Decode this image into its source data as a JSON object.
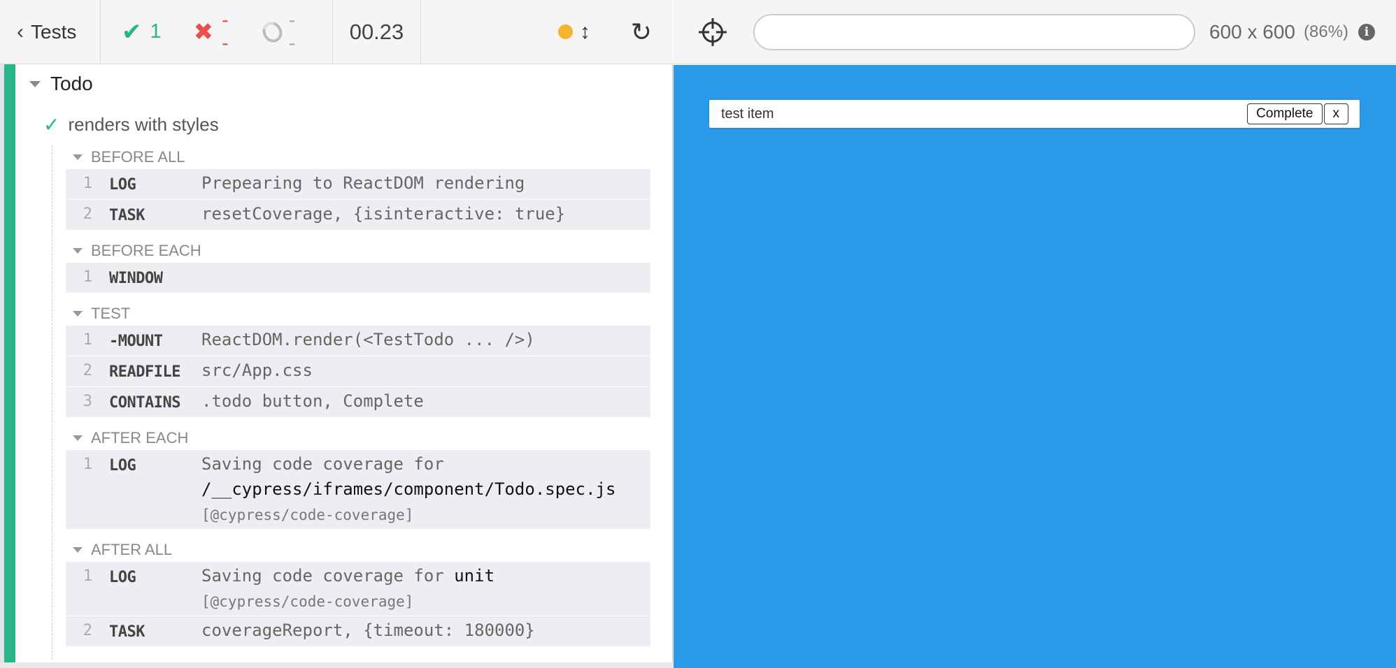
{
  "header": {
    "back_label": "Tests",
    "passed_count": "1",
    "failed_count": "--",
    "pending_count": "--",
    "duration": "00.23"
  },
  "suite": {
    "title": "Todo",
    "test": {
      "title": "renders with styles",
      "status": "passed",
      "hooks": {
        "before_all": {
          "title": "BEFORE ALL",
          "commands": [
            {
              "num": "1",
              "name": "LOG",
              "message": "Prepearing to ReactDOM rendering"
            },
            {
              "num": "2",
              "name": "TASK",
              "message": "resetCoverage, {isinteractive: true}"
            }
          ]
        },
        "before_each": {
          "title": "BEFORE EACH",
          "commands": [
            {
              "num": "1",
              "name": "WINDOW",
              "message": ""
            }
          ]
        },
        "test": {
          "title": "TEST",
          "commands": [
            {
              "num": "1",
              "name": "-MOUNT",
              "message": "ReactDOM.render(<TestTodo ... />)"
            },
            {
              "num": "2",
              "name": "READFILE",
              "message": "src/App.css"
            },
            {
              "num": "3",
              "name": "CONTAINS",
              "message": ".todo button, Complete"
            }
          ]
        },
        "after_each": {
          "title": "AFTER EACH",
          "commands": [
            {
              "num": "1",
              "name": "LOG",
              "message": "Saving code coverage for",
              "strong": "/__cypress/iframes/component/Todo.spec.js",
              "sub": "[@cypress/code-coverage]"
            }
          ]
        },
        "after_all": {
          "title": "AFTER ALL",
          "commands": [
            {
              "num": "1",
              "name": "LOG",
              "message": "Saving code coverage for",
              "strong": "unit",
              "sub": "[@cypress/code-coverage]"
            },
            {
              "num": "2",
              "name": "TASK",
              "message": "coverageReport, {timeout: 180000}"
            }
          ]
        }
      }
    }
  },
  "preview": {
    "url": "",
    "viewport_size": "600 x 600",
    "viewport_percent": "(86%)",
    "todo_text": "test item",
    "complete_label": "Complete",
    "remove_label": "x"
  },
  "colors": {
    "passed": "#29b48b",
    "failed": "#e94f4f",
    "running_dot": "#f5b32f",
    "aut_background": "#2a9beb"
  },
  "icons": {
    "back": "chevron-left-icon",
    "passed": "checkmark-icon",
    "failed": "x-icon",
    "pending": "spinner-icon",
    "running": "dot-icon",
    "auto_scroll": "up-down-arrow-icon",
    "rerun": "reload-icon",
    "selector_playground": "crosshair-icon",
    "info": "info-icon"
  }
}
